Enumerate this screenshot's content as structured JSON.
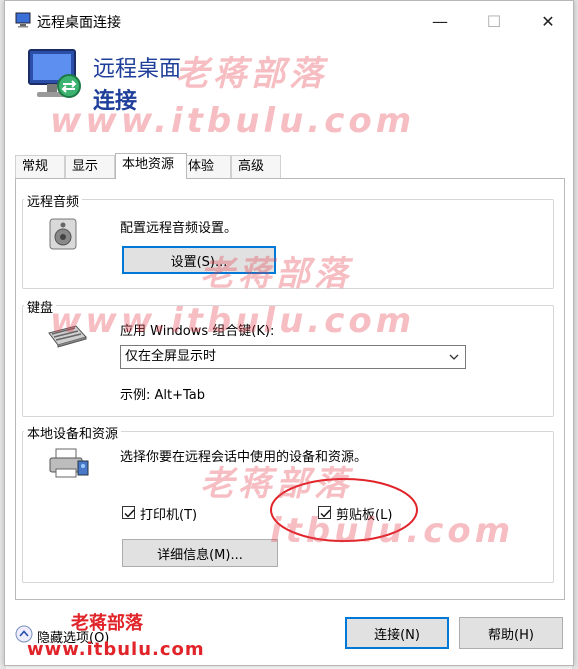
{
  "window": {
    "title": "远程桌面连接",
    "controls": {
      "minimize": "—",
      "maximize": "☐",
      "close": "✕"
    }
  },
  "banner": {
    "line1": "远程桌面",
    "line2": "连接"
  },
  "tabs": [
    "常规",
    "显示",
    "本地资源",
    "体验",
    "高级"
  ],
  "active_tab": "本地资源",
  "audio": {
    "title": "远程音频",
    "description": "配置远程音频设置。",
    "button": "设置(S)..."
  },
  "keyboard": {
    "title": "键盘",
    "label": "应用 Windows 组合键(K):",
    "selected": "仅在全屏显示时",
    "example": "示例: Alt+Tab"
  },
  "devices": {
    "title": "本地设备和资源",
    "description": "选择你要在远程会话中使用的设备和资源。",
    "printer_label": "打印机(T)",
    "printer_checked": true,
    "clipboard_label": "剪贴板(L)",
    "clipboard_checked": true,
    "details_button": "详细信息(M)..."
  },
  "footer": {
    "options_label": "隐藏选项(O)",
    "connect_button": "连接(N)",
    "help_button": "帮助(H)"
  },
  "watermark": {
    "text_cn": "老蒋部落",
    "text_en": "www.itbulu.com",
    "text_en_large": "itbulu.com"
  },
  "colors": {
    "banner_text": "#1f3f9a",
    "focus_border": "#0078d7",
    "annotation_red": "#e0242a"
  }
}
